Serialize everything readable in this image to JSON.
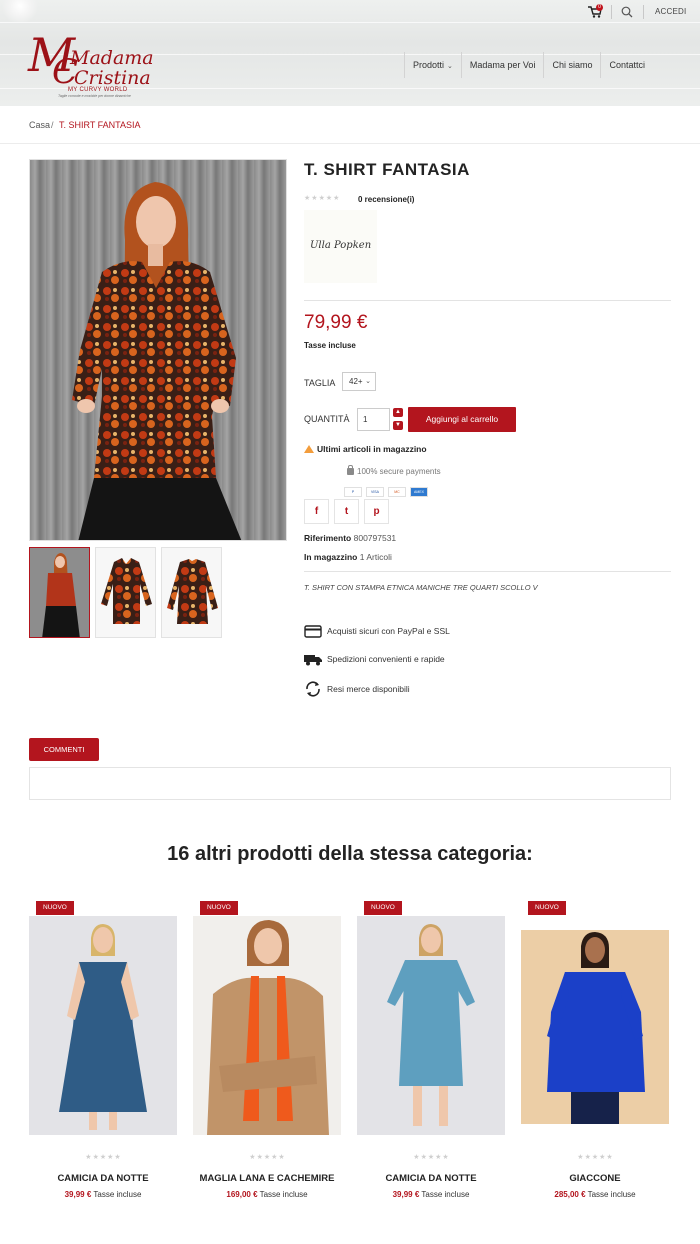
{
  "header": {
    "cart_count": "0",
    "login_label": "ACCEDI",
    "logo": {
      "line1": "Madama",
      "line2": "Cristina",
      "tagline": "MY CURVY WORLD",
      "subtitle": "Taglie comode e morbide per donne dinamiche"
    },
    "nav": [
      {
        "label": "Prodotti",
        "has_dropdown": true
      },
      {
        "label": "Madama per Voi"
      },
      {
        "label": "Chi siamo"
      },
      {
        "label": "Contattci"
      }
    ]
  },
  "breadcrumb": {
    "home": "Casa",
    "separator": "/",
    "current": "T. SHIRT FANTASIA"
  },
  "product": {
    "title": "T. SHIRT FANTASIA",
    "rating_stars": 0,
    "review_count": "0 recensione(i)",
    "brand_signature": "Ulla Popken",
    "price": "79,99 €",
    "tax_note": "Tasse incluse",
    "size_label": "TAGLIA",
    "size_value": "42+",
    "quantity_label": "QUANTITÀ",
    "quantity_value": "1",
    "add_to_cart": "Aggiungi al carrello",
    "stock_warning": "Ultimi articoli in magazzino",
    "secure_payments": "100% secure payments",
    "payment_cards": [
      "P",
      "VISA",
      "MC",
      "AMEX"
    ],
    "share": [
      "f",
      "t",
      "p"
    ],
    "reference_label": "Riferimento",
    "reference_value": "800797531",
    "stock_label": "In magazzino",
    "stock_value": "1 Articoli",
    "description": "T. SHIRT CON STAMPA ETNICA MANICHE TRE QUARTI SCOLLO V",
    "features": [
      {
        "icon": "credit-card-icon",
        "text": "Acquisti sicuri con PayPal e SSL"
      },
      {
        "icon": "truck-icon",
        "text": "Spedizioni convenienti e rapide"
      },
      {
        "icon": "refresh-icon",
        "text": "Resi merce disponibili"
      }
    ]
  },
  "tabs": {
    "comments": "COMMENTI"
  },
  "related": {
    "title": "16 altri prodotti della stessa categoria:",
    "items": [
      {
        "badge": "NUOVO",
        "name": "CAMICIA DA NOTTE",
        "price": "39,99 €",
        "tax": "Tasse incluse"
      },
      {
        "badge": "NUOVO",
        "name": "MAGLIA LANA E CACHEMIRE",
        "price": "169,00 €",
        "tax": "Tasse incluse"
      },
      {
        "badge": "NUOVO",
        "name": "CAMICIA DA NOTTE",
        "price": "39,99 €",
        "tax": "Tasse incluse"
      },
      {
        "badge": "NUOVO",
        "name": "GIACCONE",
        "price": "285,00 €",
        "tax": "Tasse incluse"
      }
    ]
  },
  "colors": {
    "accent": "#b3151e",
    "logo": "#9c1117",
    "warning": "#f39d3c"
  }
}
